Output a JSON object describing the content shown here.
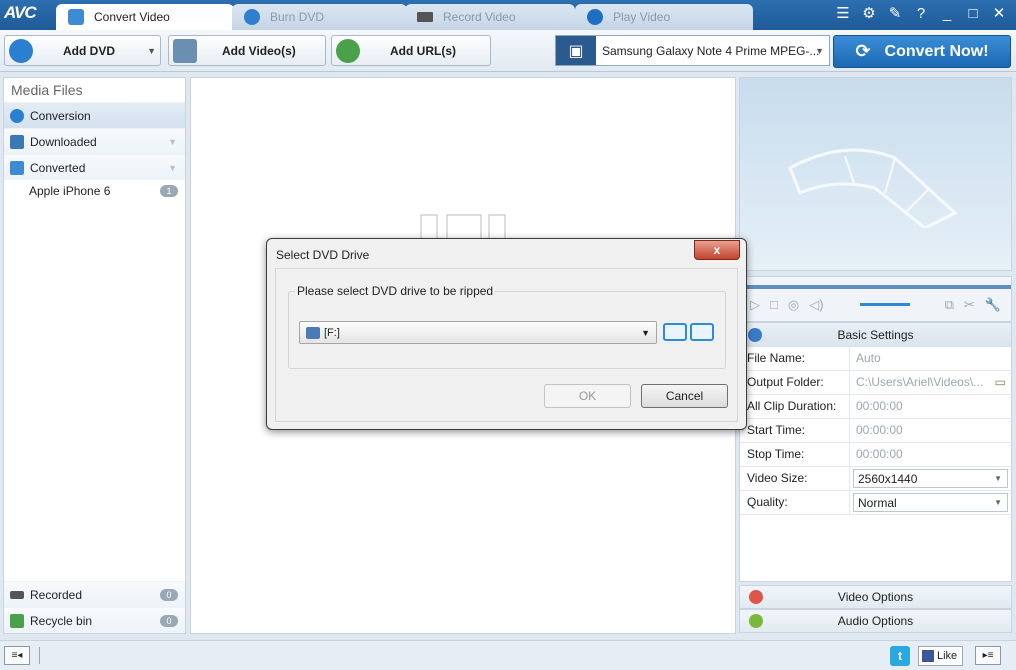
{
  "app": {
    "logo": "AVC",
    "tabs": [
      {
        "label": "Convert Video",
        "active": true
      },
      {
        "label": "Burn DVD",
        "active": false
      },
      {
        "label": "Record Video",
        "active": false
      },
      {
        "label": "Play Video",
        "active": false
      }
    ],
    "window_controls": [
      "settings-list-icon",
      "gear-icon",
      "skin-icon",
      "help-icon",
      "minimize-icon",
      "maximize-icon",
      "close-icon"
    ]
  },
  "toolbar": {
    "add_dvd": "Add DVD",
    "add_videos": "Add Video(s)",
    "add_url": "Add URL(s)",
    "profile": "Samsung Galaxy Note 4 Prime MPEG-...",
    "convert_now": "Convert Now!"
  },
  "left_panel": {
    "header": "Media Files",
    "items": [
      {
        "label": "Conversion"
      },
      {
        "label": "Downloaded"
      },
      {
        "label": "Converted"
      }
    ],
    "subitems": [
      {
        "label": "Apple iPhone 6",
        "count": "1"
      }
    ],
    "bottom_items": [
      {
        "label": "Recorded",
        "count": "0"
      },
      {
        "label": "Recycle bin",
        "count": "0"
      }
    ]
  },
  "settings": {
    "header": "Basic Settings",
    "rows": [
      {
        "label": "File Name:",
        "value": "Auto"
      },
      {
        "label": "Output Folder:",
        "value": "C:\\Users\\Ariel\\Videos\\..."
      },
      {
        "label": "All Clip Duration:",
        "value": "00:00:00"
      },
      {
        "label": "Start Time:",
        "value": "00:00:00"
      },
      {
        "label": "Stop Time:",
        "value": "00:00:00"
      },
      {
        "label": "Video Size:",
        "value": "2560x1440"
      },
      {
        "label": "Quality:",
        "value": "Normal"
      }
    ],
    "video_options": "Video Options",
    "audio_options": "Audio Options"
  },
  "status_bar": {
    "like": "Like"
  },
  "dialog": {
    "title": "Select DVD Drive",
    "close": "x",
    "group_label": "Please select DVD drive to be ripped",
    "drive": "[F:]",
    "ok": "OK",
    "cancel": "Cancel"
  },
  "colors": {
    "titlebar": "#1d5a98",
    "accent": "#2b8bd6",
    "close_red": "#c4422b"
  }
}
